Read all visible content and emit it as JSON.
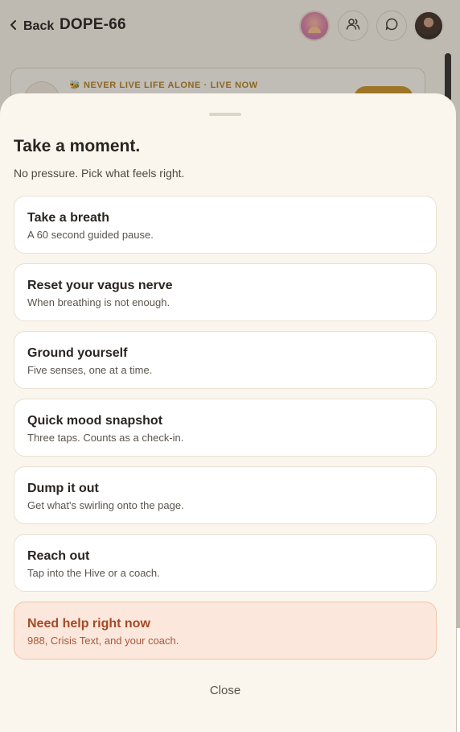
{
  "header": {
    "back_label": "Back",
    "title": "DOPE-66"
  },
  "banner": {
    "tag": "🐝 NEVER LIVE LIFE ALONE · LIVE NOW"
  },
  "sheet": {
    "title": "Take a moment.",
    "subtitle": "No pressure. Pick what feels right.",
    "options": [
      {
        "title": "Take a breath",
        "desc": "A 60 second guided pause."
      },
      {
        "title": "Reset your vagus nerve",
        "desc": "When breathing is not enough."
      },
      {
        "title": "Ground yourself",
        "desc": "Five senses, one at a time."
      },
      {
        "title": "Quick mood snapshot",
        "desc": "Three taps. Counts as a check-in."
      },
      {
        "title": "Dump it out",
        "desc": "Get what's swirling onto the page."
      },
      {
        "title": "Reach out",
        "desc": "Tap into the Hive or a coach."
      },
      {
        "title": "Need help right now",
        "desc": "988, Crisis Text, and your coach."
      }
    ],
    "close_label": "Close"
  },
  "icons": {
    "back": "chevron-left-icon",
    "people": "people-icon",
    "chat": "chat-bubble-icon"
  },
  "colors": {
    "sheet_bg": "#faf6ee",
    "crisis_bg": "#fbe7dc",
    "crisis_text": "#a34a26",
    "accent_gold": "#c99021"
  }
}
